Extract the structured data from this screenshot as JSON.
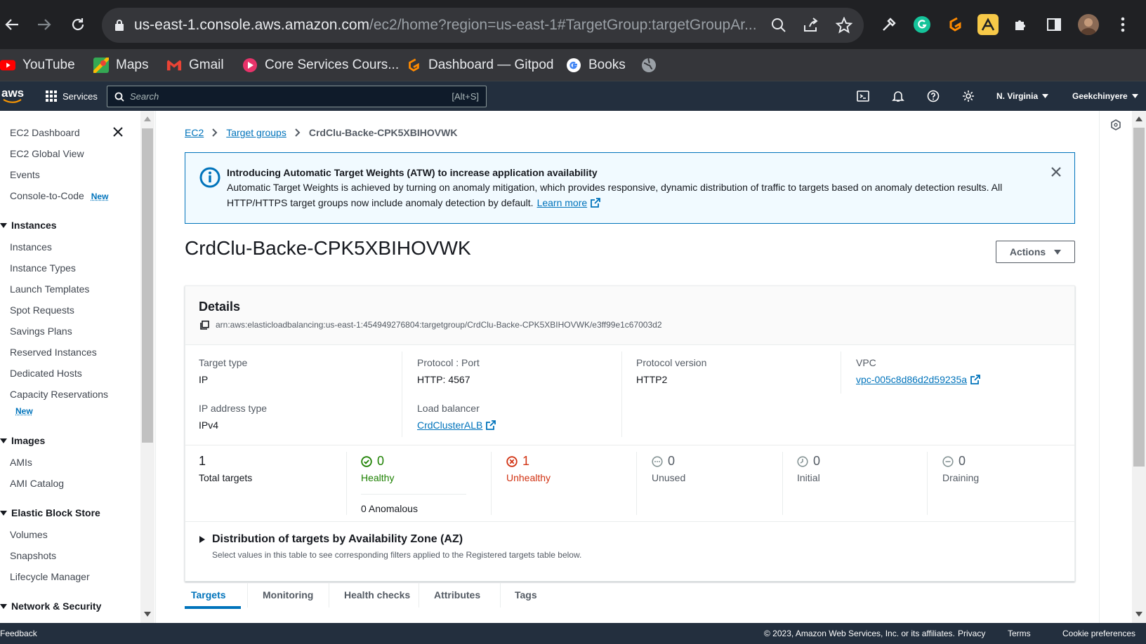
{
  "browser": {
    "url_host": "us-east-1.console.aws.amazon.com",
    "url_rest": "/ec2/home?region=us-east-1#TargetGroup:targetGroupAr...",
    "bookmarks": [
      {
        "label": "YouTube"
      },
      {
        "label": "Maps"
      },
      {
        "label": "Gmail"
      },
      {
        "label": "Core Services Cours..."
      },
      {
        "label": "Dashboard — Gitpod"
      },
      {
        "label": "Books"
      }
    ]
  },
  "aws_nav": {
    "logo": "aws",
    "services": "Services",
    "search_placeholder": "Search",
    "search_shortcut": "[Alt+S]",
    "region": "N. Virginia",
    "user": "Geekchinyere"
  },
  "sidebar": {
    "top_items": [
      "EC2 Dashboard",
      "EC2 Global View",
      "Events",
      "Console-to-Code"
    ],
    "new_badge": "New",
    "instances_head": "Instances",
    "instances": [
      "Instances",
      "Instance Types",
      "Launch Templates",
      "Spot Requests",
      "Savings Plans",
      "Reserved Instances",
      "Dedicated Hosts",
      "Capacity Reservations"
    ],
    "images_head": "Images",
    "images": [
      "AMIs",
      "AMI Catalog"
    ],
    "ebs_head": "Elastic Block Store",
    "ebs": [
      "Volumes",
      "Snapshots",
      "Lifecycle Manager"
    ],
    "netsec_head": "Network & Security"
  },
  "breadcrumb": {
    "root": "EC2",
    "parent": "Target groups",
    "current": "CrdClu-Backe-CPK5XBIHOVWK"
  },
  "info": {
    "title": "Introducing Automatic Target Weights (ATW) to increase application availability",
    "body_line1": "Automatic Target Weights is achieved by turning on anomaly mitigation, which provides responsive, dynamic distribution of traffic to targets based on anomaly detection results. All",
    "body_line2": "HTTP/HTTPS target groups now include anomaly detection by default.",
    "learn_more": "Learn more"
  },
  "page": {
    "title": "CrdClu-Backe-CPK5XBIHOVWK",
    "actions": "Actions"
  },
  "details": {
    "heading": "Details",
    "arn": "arn:aws:elasticloadbalancing:us-east-1:454949276804:targetgroup/CrdClu-Backe-CPK5XBIHOVWK/e3ff99e1c67003d2",
    "target_type_label": "Target type",
    "target_type": "IP",
    "ip_type_label": "IP address type",
    "ip_type": "IPv4",
    "protocol_label": "Protocol : Port",
    "protocol": "HTTP: 4567",
    "lb_label": "Load balancer",
    "lb": "CrdClusterALB",
    "proto_ver_label": "Protocol version",
    "proto_ver": "HTTP2",
    "vpc_label": "VPC",
    "vpc": "vpc-005c8d86d2d59235a"
  },
  "counts": {
    "total": "1",
    "total_label": "Total targets",
    "healthy": "0",
    "healthy_label": "Healthy",
    "anomalous": "0 Anomalous",
    "unhealthy": "1",
    "unhealthy_label": "Unhealthy",
    "unused": "0",
    "unused_label": "Unused",
    "initial": "0",
    "initial_label": "Initial",
    "draining": "0",
    "draining_label": "Draining"
  },
  "distribution": {
    "title": "Distribution of targets by Availability Zone (AZ)",
    "subtitle": "Select values in this table to see corresponding filters applied to the Registered targets table below."
  },
  "tabs": [
    "Targets",
    "Monitoring",
    "Health checks",
    "Attributes",
    "Tags"
  ],
  "footer": {
    "feedback": "Feedback",
    "copyright": "© 2023, Amazon Web Services, Inc. or its affiliates.",
    "privacy": "Privacy",
    "terms": "Terms",
    "cookies": "Cookie preferences"
  },
  "colors": {
    "link": "#0073bb",
    "healthy": "#1d8102",
    "unhealthy": "#d13212",
    "nav_bg": "#232f3e"
  }
}
